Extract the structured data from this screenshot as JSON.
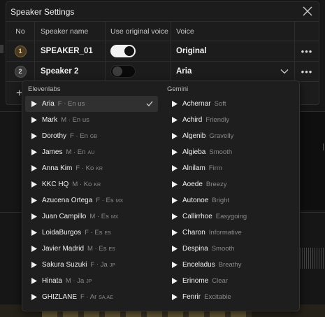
{
  "modal": {
    "title": "Speaker Settings",
    "columns": {
      "no": "No",
      "name": "Speaker name",
      "use_original": "Use original voice",
      "voice": "Voice"
    },
    "rows": [
      {
        "no": "1",
        "name": "SPEAKER_01",
        "use_original": true,
        "voice": "Original",
        "more": "•••"
      },
      {
        "no": "2",
        "name": "Speaker 2",
        "use_original": false,
        "voice": "Aria",
        "more": "•••"
      }
    ],
    "add_label": "+"
  },
  "dropdown": {
    "groups": [
      {
        "title": "Elevenlabs",
        "options": [
          {
            "name": "Aria",
            "meta": "F · En us",
            "accent": "",
            "selected": true
          },
          {
            "name": "Mark",
            "meta": "M · En us",
            "accent": ""
          },
          {
            "name": "Dorothy",
            "meta": "F · En",
            "accent": "GB"
          },
          {
            "name": "James",
            "meta": "M · En",
            "accent": "AU"
          },
          {
            "name": "Anna Kim",
            "meta": "F · Ko",
            "accent": "KR"
          },
          {
            "name": "KKC HQ",
            "meta": "M · Ko",
            "accent": "KR"
          },
          {
            "name": "Azucena Ortega",
            "meta": "F · Es",
            "accent": "MX"
          },
          {
            "name": "Juan Campillo",
            "meta": "M · Es",
            "accent": "MX"
          },
          {
            "name": "LoidaBurgos",
            "meta": "F · Es",
            "accent": "ES"
          },
          {
            "name": "Javier Madrid",
            "meta": "M · Es",
            "accent": "ES"
          },
          {
            "name": "Sakura Suzuki",
            "meta": "F · Ja",
            "accent": "JP"
          },
          {
            "name": "Hinata",
            "meta": "M · Ja",
            "accent": "JP"
          },
          {
            "name": "GHIZLANE",
            "meta": "F · Ar",
            "accent": "SA,AE"
          }
        ]
      },
      {
        "title": "Gemini",
        "options": [
          {
            "name": "Achernar",
            "meta": "Soft"
          },
          {
            "name": "Achird",
            "meta": "Friendly"
          },
          {
            "name": "Algenib",
            "meta": "Gravelly"
          },
          {
            "name": "Algieba",
            "meta": "Smooth"
          },
          {
            "name": "Alnilam",
            "meta": "Firm"
          },
          {
            "name": "Aoede",
            "meta": "Breezy"
          },
          {
            "name": "Autonoe",
            "meta": "Bright"
          },
          {
            "name": "Callirrhoe",
            "meta": "Easygoing"
          },
          {
            "name": "Charon",
            "meta": "Informative"
          },
          {
            "name": "Despina",
            "meta": "Smooth"
          },
          {
            "name": "Enceladus",
            "meta": "Breathy"
          },
          {
            "name": "Erinome",
            "meta": "Clear"
          },
          {
            "name": "Fenrir",
            "meta": "Excitable"
          }
        ]
      }
    ]
  },
  "icons": {
    "close": "close-icon",
    "more": "more-horizontal-icon",
    "chevron": "chevron-down-icon",
    "play": "play-icon",
    "check": "check-icon",
    "add": "plus-icon"
  },
  "colors": {
    "panel": "#1c1c1c",
    "dropdown": "#1e1e1e",
    "selected_row": "#303030",
    "muted_text": "#8a8a8a",
    "badge_gold": "#e4c48c"
  }
}
